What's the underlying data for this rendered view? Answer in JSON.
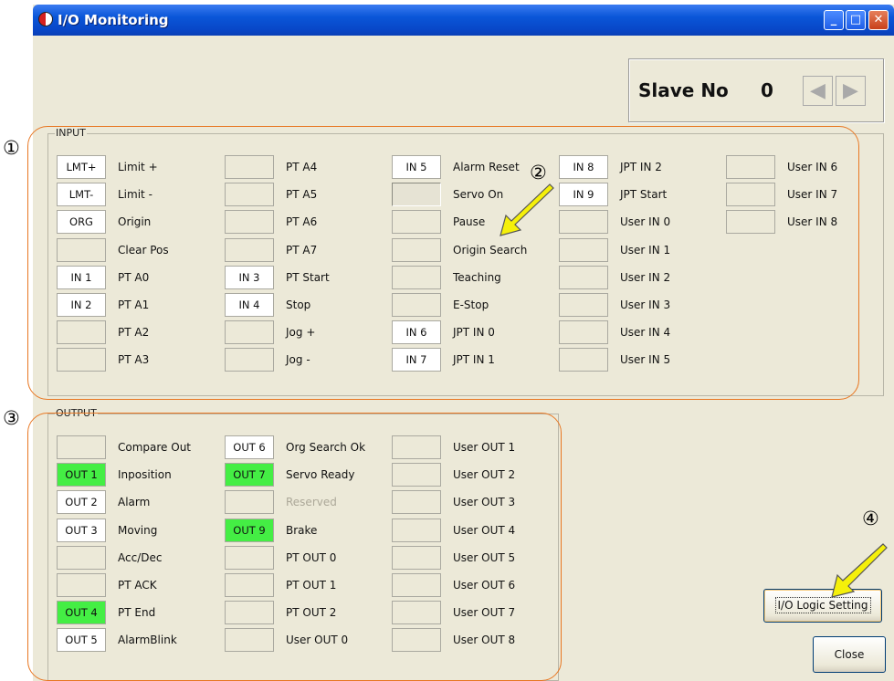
{
  "window": {
    "title": "I/O Monitoring",
    "min_glyph": "_",
    "max_glyph": "□",
    "close_glyph": "✕"
  },
  "slave": {
    "label": "Slave No",
    "value": "0",
    "prev_glyph": "◀",
    "next_glyph": "▶"
  },
  "input": {
    "label": "INPUT",
    "columns": [
      [
        {
          "led": "LMT+",
          "state": "on",
          "label": "Limit +"
        },
        {
          "led": "LMT-",
          "state": "on",
          "label": "Limit -"
        },
        {
          "led": "ORG",
          "state": "on",
          "label": "Origin"
        },
        {
          "led": "",
          "state": "off",
          "label": "Clear Pos"
        },
        {
          "led": "IN 1",
          "state": "on",
          "label": "PT A0"
        },
        {
          "led": "IN 2",
          "state": "on",
          "label": "PT A1"
        },
        {
          "led": "",
          "state": "off",
          "label": "PT A2"
        },
        {
          "led": "",
          "state": "off",
          "label": "PT A3"
        }
      ],
      [
        {
          "led": "",
          "state": "off",
          "label": "PT A4"
        },
        {
          "led": "",
          "state": "off",
          "label": "PT A5"
        },
        {
          "led": "",
          "state": "off",
          "label": "PT A6"
        },
        {
          "led": "",
          "state": "off",
          "label": "PT A7"
        },
        {
          "led": "IN 3",
          "state": "on",
          "label": "PT Start"
        },
        {
          "led": "IN 4",
          "state": "on",
          "label": "Stop"
        },
        {
          "led": "",
          "state": "off",
          "label": "Jog +"
        },
        {
          "led": "",
          "state": "off",
          "label": "Jog -"
        }
      ],
      [
        {
          "led": "IN 5",
          "state": "on",
          "label": "Alarm Reset"
        },
        {
          "led": "",
          "state": "sunk",
          "label": "Servo On"
        },
        {
          "led": "",
          "state": "off",
          "label": "Pause"
        },
        {
          "led": "",
          "state": "off",
          "label": "Origin Search"
        },
        {
          "led": "",
          "state": "off",
          "label": "Teaching"
        },
        {
          "led": "",
          "state": "off",
          "label": "E-Stop"
        },
        {
          "led": "IN 6",
          "state": "on",
          "label": "JPT IN 0"
        },
        {
          "led": "IN 7",
          "state": "on",
          "label": "JPT IN 1"
        }
      ],
      [
        {
          "led": "IN 8",
          "state": "on",
          "label": "JPT IN 2"
        },
        {
          "led": "IN 9",
          "state": "on",
          "label": "JPT Start"
        },
        {
          "led": "",
          "state": "off",
          "label": "User IN 0"
        },
        {
          "led": "",
          "state": "off",
          "label": "User IN 1"
        },
        {
          "led": "",
          "state": "off",
          "label": "User IN 2"
        },
        {
          "led": "",
          "state": "off",
          "label": "User IN 3"
        },
        {
          "led": "",
          "state": "off",
          "label": "User IN 4"
        },
        {
          "led": "",
          "state": "off",
          "label": "User IN 5"
        }
      ],
      [
        {
          "led": "",
          "state": "off",
          "label": "User IN 6"
        },
        {
          "led": "",
          "state": "off",
          "label": "User IN 7"
        },
        {
          "led": "",
          "state": "off",
          "label": "User IN 8"
        }
      ]
    ]
  },
  "output": {
    "label": "OUTPUT",
    "columns": [
      [
        {
          "led": "",
          "state": "off",
          "label": "Compare Out"
        },
        {
          "led": "OUT 1",
          "state": "green",
          "label": "Inposition"
        },
        {
          "led": "OUT 2",
          "state": "on",
          "label": "Alarm"
        },
        {
          "led": "OUT 3",
          "state": "on",
          "label": "Moving"
        },
        {
          "led": "",
          "state": "off",
          "label": "Acc/Dec"
        },
        {
          "led": "",
          "state": "off",
          "label": "PT ACK"
        },
        {
          "led": "OUT 4",
          "state": "green",
          "label": "PT End"
        },
        {
          "led": "OUT 5",
          "state": "on",
          "label": "AlarmBlink"
        }
      ],
      [
        {
          "led": "OUT 6",
          "state": "on",
          "label": "Org Search Ok"
        },
        {
          "led": "OUT 7",
          "state": "green",
          "label": "Servo Ready"
        },
        {
          "led": "",
          "state": "off",
          "label": "Reserved",
          "disabled": true
        },
        {
          "led": "OUT 9",
          "state": "green",
          "label": "Brake"
        },
        {
          "led": "",
          "state": "off",
          "label": "PT OUT 0"
        },
        {
          "led": "",
          "state": "off",
          "label": "PT OUT 1"
        },
        {
          "led": "",
          "state": "off",
          "label": "PT OUT 2"
        },
        {
          "led": "",
          "state": "off",
          "label": "User OUT 0"
        }
      ],
      [
        {
          "led": "",
          "state": "off",
          "label": "User OUT 1"
        },
        {
          "led": "",
          "state": "off",
          "label": "User OUT 2"
        },
        {
          "led": "",
          "state": "off",
          "label": "User OUT 3"
        },
        {
          "led": "",
          "state": "off",
          "label": "User OUT 4"
        },
        {
          "led": "",
          "state": "off",
          "label": "User OUT 5"
        },
        {
          "led": "",
          "state": "off",
          "label": "User OUT 6"
        },
        {
          "led": "",
          "state": "off",
          "label": "User OUT 7"
        },
        {
          "led": "",
          "state": "off",
          "label": "User OUT 8"
        }
      ]
    ]
  },
  "buttons": {
    "logic": "I/O Logic Setting",
    "close": "Close"
  },
  "annotations": {
    "m1": "①",
    "m2": "②",
    "m3": "③",
    "m4": "④"
  },
  "colors": {
    "led_on": "#ffffff",
    "led_active": "#44ee44",
    "led_off": "#ece9d8",
    "highlight": "#e87722",
    "pointer": "#f5f00a"
  }
}
